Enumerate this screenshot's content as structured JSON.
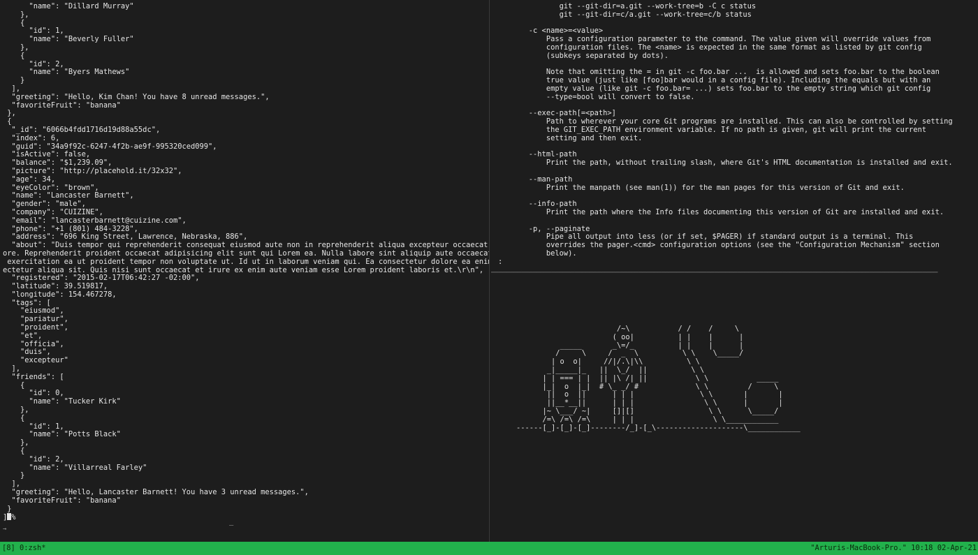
{
  "left_pane": {
    "lines": [
      "      \"name\": \"Dillard Murray\"",
      "    },",
      "    {",
      "      \"id\": 1,",
      "      \"name\": \"Beverly Fuller\"",
      "    },",
      "    {",
      "      \"id\": 2,",
      "      \"name\": \"Byers Mathews\"",
      "    }",
      "  ],",
      "  \"greeting\": \"Hello, Kim Chan! You have 8 unread messages.\",",
      "  \"favoriteFruit\": \"banana\"",
      " },",
      " {",
      "  \"_id\": \"6066b4fdd1716d19d88a55dc\",",
      "  \"index\": 6,",
      "  \"guid\": \"34a9f92c-6247-4f2b-ae9f-995320ced099\",",
      "  \"isActive\": false,",
      "  \"balance\": \"$1,239.09\",",
      "  \"picture\": \"http://placehold.it/32x32\",",
      "  \"age\": 34,",
      "  \"eyeColor\": \"brown\",",
      "  \"name\": \"Lancaster Barnett\",",
      "  \"gender\": \"male\",",
      "  \"company\": \"CUIZINE\",",
      "  \"email\": \"lancasterbarnett@cuizine.com\",",
      "  \"phone\": \"+1 (801) 484-3228\",",
      "  \"address\": \"696 King Street, Lawrence, Nebraska, 886\",",
      "  \"about\": \"Duis tempor qui reprehenderit consequat eiusmod aute non in reprehenderit aliqua excepteur occaecat lab",
      "ore. Reprehenderit proident occaecat adipisicing elit sunt qui Lorem ea. Nulla labore sint aliquip aute occaecat esse",
      " exercitation ea ut proident tempor non voluptate ut. Id ut in laborum veniam qui. Ea consectetur dolore ea enim cons",
      "ectetur aliqua sit. Quis nisi sunt occaecat et irure ex enim aute veniam esse Lorem proident laboris et.\\r\\n\",",
      "  \"registered\": \"2015-02-17T06:42:27 -02:00\",",
      "  \"latitude\": 39.519817,",
      "  \"longitude\": 154.467278,",
      "  \"tags\": [",
      "    \"eiusmod\",",
      "    \"pariatur\",",
      "    \"proident\",",
      "    \"et\",",
      "    \"officia\",",
      "    \"duis\",",
      "    \"excepteur\"",
      "  ],",
      "  \"friends\": [",
      "    {",
      "      \"id\": 0,",
      "      \"name\": \"Tucker Kirk\"",
      "    },",
      "    {",
      "      \"id\": 1,",
      "      \"name\": \"Potts Black\"",
      "    },",
      "    {",
      "      \"id\": 2,",
      "      \"name\": \"Villarreal Farley\"",
      "    }",
      "  ],",
      "  \"greeting\": \"Hello, Lancaster Barnett! You have 3 unread messages.\",",
      "  \"favoriteFruit\": \"banana\"",
      " }",
      "]"
    ],
    "prompt_tail": "%",
    "arrow": "→",
    "underscore": "_"
  },
  "right_top": {
    "lines": [
      "              git --git-dir=a.git --work-tree=b -C c status",
      "              git --git-dir=c/a.git --work-tree=c/b status",
      "",
      "       -c <name>=<value>",
      "           Pass a configuration parameter to the command. The value given will override values from",
      "           configuration files. The <name> is expected in the same format as listed by git config",
      "           (subkeys separated by dots).",
      "",
      "           Note that omitting the = in git -c foo.bar ...  is allowed and sets foo.bar to the boolean",
      "           true value (just like [foo]bar would in a config file). Including the equals but with an",
      "           empty value (like git -c foo.bar= ...) sets foo.bar to the empty string which git config",
      "           --type=bool will convert to false.",
      "",
      "       --exec-path[=<path>]",
      "           Path to wherever your core Git programs are installed. This can also be controlled by setting",
      "           the GIT_EXEC_PATH environment variable. If no path is given, git will print the current",
      "           setting and then exit.",
      "",
      "       --html-path",
      "           Print the path, without trailing slash, where Git's HTML documentation is installed and exit.",
      "",
      "       --man-path",
      "           Print the manpath (see man(1)) for the man pages for this version of Git and exit.",
      "",
      "       --info-path",
      "           Print the path where the Info files documenting this version of Git are installed and exit.",
      "",
      "       -p, --paginate",
      "           Pipe all output into less (or if set, $PAGER) if standard output is a terminal. This",
      "           overrides the pager.<cmd> configuration options (see the \"Configuration Mechanism\" section",
      "           below).",
      ":"
    ]
  },
  "right_bottom": {
    "ascii_art": [
      "                       /~\\           / /    /     \\",
      "                      ( oo|          | |    |      |",
      "          _____       _\\=/_          | |    |      |",
      "         /     \\     /  _  \\          \\ \\    \\_____/",
      "        | o  o|     //|/.\\|\\\\          \\ \\",
      "       _|_____|_   ||  \\_/  ||          \\ \\",
      "      | | === | |  || |\\ /| ||           \\ \\           _____",
      "      |_|  o  |_|  # \\_ _/ #             \\ \\         /     \\",
      "       ||  o  ||      | | |               \\ \\       |       |",
      "       ||__*__||      | | |                \\ \\      |       |",
      "      |~ \\___/ ~|     []|[]                 \\ \\      \\_____/",
      "      /=\\ /=\\ /=\\     | | |                  \\ \\____________",
      "------[_]-[_]-[_]--------/_]-[_\\--------------------\\____________"
    ]
  },
  "status_bar": {
    "left": "[8] 0:zsh*",
    "right": "\"Arturis-MacBook-Pro.\" 10:18 02-Apr-21"
  },
  "colors": {
    "background": "#1d1d1d",
    "text": "#e6e6e6",
    "status_bar": "#22b14c"
  }
}
